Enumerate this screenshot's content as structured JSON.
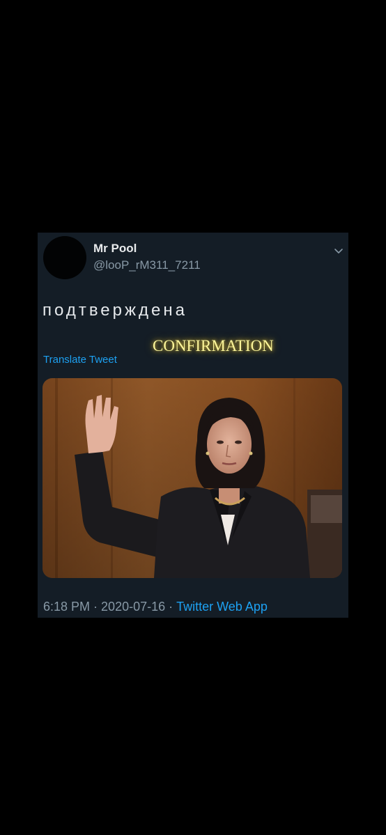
{
  "tweet": {
    "display_name": "Mr Pool",
    "handle": "@looP_rM311_7211",
    "text": "подтверждена",
    "translate_label": "Translate Tweet",
    "overlay_caption": "CONFIRMATION",
    "time": "6:18 PM",
    "date": "2020-07-16",
    "separator": "·",
    "source": "Twitter Web App",
    "icons": {
      "more": "chevron-down-icon"
    }
  },
  "colors": {
    "page_background": "#000000",
    "card_background": "#141d26",
    "primary_text": "#e6e9ec",
    "secondary_text": "#8899a6",
    "link": "#1da1f2",
    "caption_glow": "#fbf59a"
  }
}
